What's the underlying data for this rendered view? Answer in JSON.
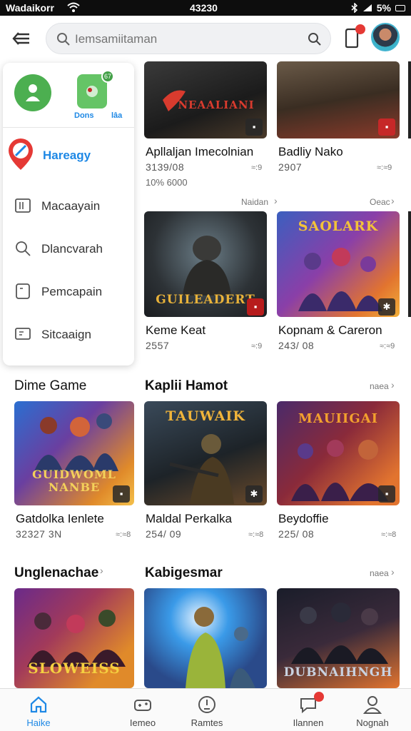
{
  "status_bar": {
    "carrier": "Wadaikorr",
    "time": "43230",
    "battery": "5%"
  },
  "header": {
    "search_placeholder": "Iemsamiitaman",
    "notification_badge": "!"
  },
  "drawer": {
    "mini_label_a": "Dons",
    "mini_label_b": "lâa",
    "active_item": "Hareagy",
    "items": [
      {
        "label": "Macaayain",
        "icon": "square-icon"
      },
      {
        "label": "Dlancvarah",
        "icon": "search-icon"
      },
      {
        "label": "Pemcapain",
        "icon": "page-icon"
      },
      {
        "label": "Sitcaaign",
        "icon": "screen-icon"
      }
    ]
  },
  "top_row": [
    {
      "title": "Apllaljan Imecolnian",
      "meta": "3139/08",
      "extra": "10% 6000",
      "meta_r": "≈:9",
      "art": "NEAALIANI",
      "art_color": "#d93b2e"
    },
    {
      "title": "Badliy Nako",
      "meta": "2907",
      "meta_r": "≈:≈9",
      "more": "Oeac"
    }
  ],
  "row2_more_left": "Naidan",
  "row2": [
    {
      "title": "Keme Keat",
      "meta": "2557",
      "meta_r": "≈:9",
      "art": "GUILEADERT",
      "art_color": "#e8b23a"
    },
    {
      "title": "Kopnam & Careron",
      "meta": "243/ 08",
      "meta_r": "≈:≈9",
      "art": "SAOLARK",
      "art_color": "#f2c23a"
    }
  ],
  "sections": {
    "dime_game": "Dime Game",
    "kaplii": "Kaplii Hamot",
    "kaplii_more": "naea",
    "unglen": "Unglenachae",
    "kabig": "Kabigesmar",
    "kabig_more": "naea"
  },
  "row3": [
    {
      "title": "Gatdolka Ienlete",
      "meta": "32327 3N",
      "meta_r": "≈:≈8",
      "art": "GUIDWOML NANBE",
      "art_color": "#f4d05a"
    },
    {
      "title": "Maldal Perkalka",
      "meta": "254/ 09",
      "meta_r": "≈:≈8",
      "art": "TAUWAIK",
      "art_color": "#f0b43a"
    },
    {
      "title": "Beydoffie",
      "meta": "225/ 08",
      "meta_r": "≈:≈8",
      "art": "MAUIIGAI",
      "art_color": "#f2a02e"
    }
  ],
  "row4": [
    {
      "art": "SLOWEISS",
      "art_color": "#f5d040"
    },
    {
      "art": "",
      "art_color": "#ffffff"
    },
    {
      "art": "DUBNAIHNGH",
      "art_color": "#c9d2e0"
    }
  ],
  "bottom_nav": [
    {
      "label": "Haike",
      "icon": "home-icon",
      "active": true
    },
    {
      "label": "Iemeo",
      "icon": "gamepad-icon",
      "active": false
    },
    {
      "label": "Ramtes",
      "icon": "clock-icon",
      "active": false
    },
    {
      "label": "Ilannen",
      "icon": "chat-icon",
      "active": false
    },
    {
      "label": "Nognah",
      "icon": "profile-icon",
      "active": false
    }
  ],
  "colors": {
    "accent": "#1e88e5",
    "drawer_green": "#4caf50",
    "badge_red": "#e53935"
  }
}
